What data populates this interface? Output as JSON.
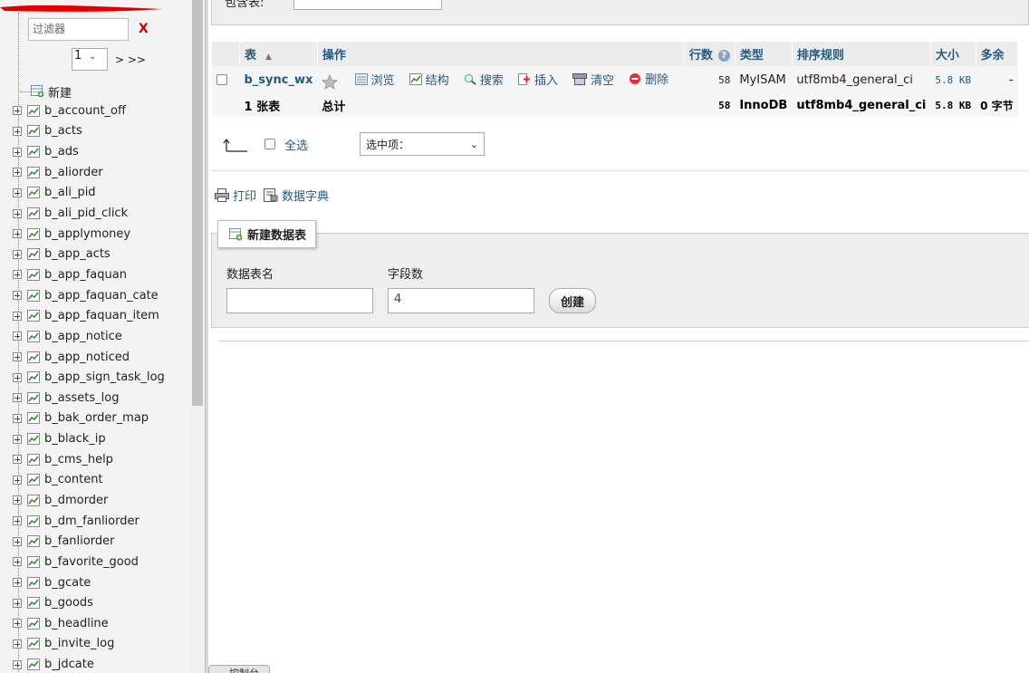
{
  "nav": {
    "filter_placeholder": "过滤器",
    "filter_clear": "X",
    "page_value": "1",
    "page_next": "> >>",
    "new_label": "新建",
    "tables": [
      "b_account_off",
      "b_acts",
      "b_ads",
      "b_aliorder",
      "b_ali_pid",
      "b_ali_pid_click",
      "b_applymoney",
      "b_app_acts",
      "b_app_faquan",
      "b_app_faquan_cate",
      "b_app_faquan_item",
      "b_app_notice",
      "b_app_noticed",
      "b_app_sign_task_log",
      "b_assets_log",
      "b_bak_order_map",
      "b_black_ip",
      "b_cms_help",
      "b_content",
      "b_dmorder",
      "b_dm_fanliorder",
      "b_fanliorder",
      "b_favorite_good",
      "b_gcate",
      "b_goods",
      "b_headline",
      "b_invite_log",
      "b_jdcate"
    ]
  },
  "top": {
    "label_fragment": "包含表:"
  },
  "table": {
    "headers": {
      "table": "表",
      "action": "操作",
      "rows": "行数",
      "type": "类型",
      "collation": "排序规则",
      "size": "大小",
      "overhead": "多余"
    },
    "row": {
      "name": "b_sync_wx",
      "actions": {
        "browse": "浏览",
        "structure": "结构",
        "search": "搜索",
        "insert": "插入",
        "empty": "清空",
        "drop": "删除"
      },
      "rows": "58",
      "type": "MyISAM",
      "collation": "utf8mb4_general_ci",
      "size": "5.8 KB",
      "overhead": "-"
    },
    "summary": {
      "count": "1 张表",
      "label": "总计",
      "rows": "58",
      "type": "InnoDB",
      "collation": "utf8mb4_general_ci",
      "size": "5.8 KB",
      "overhead": "0 字节"
    }
  },
  "bulk": {
    "check_all": "全选",
    "with_selected": "选中项："
  },
  "links": {
    "print": "打印",
    "dictionary": "数据字典"
  },
  "create": {
    "legend": "新建数据表",
    "name_label": "数据表名",
    "name_value": "",
    "fields_label": "字段数",
    "fields_value": "4",
    "button": "创建"
  },
  "console": {
    "label": "控制台"
  },
  "colors": {
    "link": "#235a81",
    "header_bg": "#ececec",
    "panel_bg": "#eeeeee"
  }
}
